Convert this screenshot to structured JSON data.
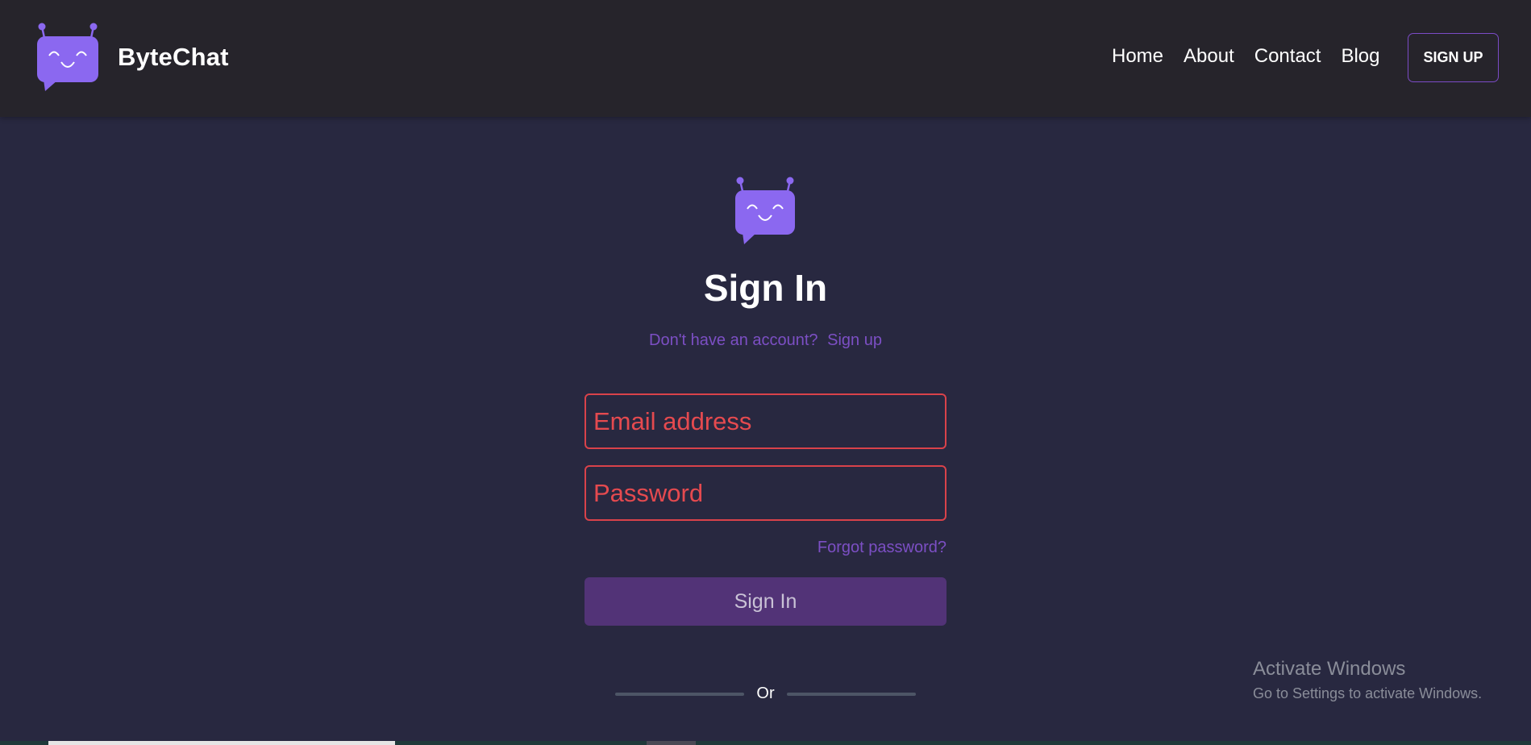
{
  "navbar": {
    "brand_name": "ByteChat",
    "links": [
      "Home",
      "About",
      "Contact",
      "Blog"
    ],
    "signup_label": "SIGN UP"
  },
  "main": {
    "title": "Sign In",
    "account_prompt": "Don't have an account?",
    "signup_link": "Sign up",
    "email_placeholder": "Email address",
    "password_placeholder": "Password",
    "forgot_password": "Forgot password?",
    "signin_button": "Sign In",
    "divider_text": "Or"
  },
  "watermark": {
    "title": "Activate Windows",
    "subtitle": "Go to Settings to activate Windows."
  },
  "icons": {
    "logo": "smiling-chat-bubble-robot-icon"
  },
  "colors": {
    "navbar_bg": "#26242b",
    "page_bg": "#282840",
    "accent": "#7c4fc4",
    "logo_purple": "#8b68f0",
    "error_red": "#d9424a",
    "button_bg": "#523377"
  }
}
